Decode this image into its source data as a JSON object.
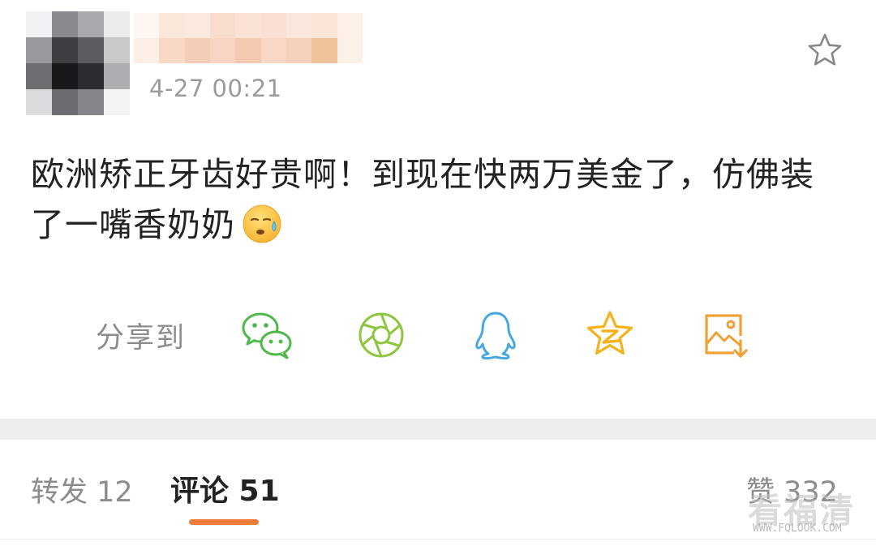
{
  "post": {
    "timestamp": "4-27 00:21",
    "text": "欧洲矫正牙齿好贵啊！到现在快两万美金了，仿佛装了一嘴香奶奶",
    "emoji": "sweat-smile-emoji"
  },
  "share": {
    "label": "分享到",
    "targets": [
      {
        "name": "wechat",
        "icon": "wechat-icon",
        "color": "#4fb84a"
      },
      {
        "name": "moments",
        "icon": "moments-icon",
        "color": "#8cc63f"
      },
      {
        "name": "qq",
        "icon": "qq-icon",
        "color": "#4aa8e0"
      },
      {
        "name": "qzone",
        "icon": "qzone-icon",
        "color": "#f5b21a"
      },
      {
        "name": "save-image",
        "icon": "save-image-icon",
        "color": "#f0a035"
      }
    ]
  },
  "tabs": {
    "repost_label": "转发 12",
    "comment_label": "评论 51",
    "like_label": "赞 332",
    "accent_color": "#f07c3c"
  },
  "watermark": {
    "text": "看福清",
    "url": "WWW.FQLOOK.COM"
  }
}
